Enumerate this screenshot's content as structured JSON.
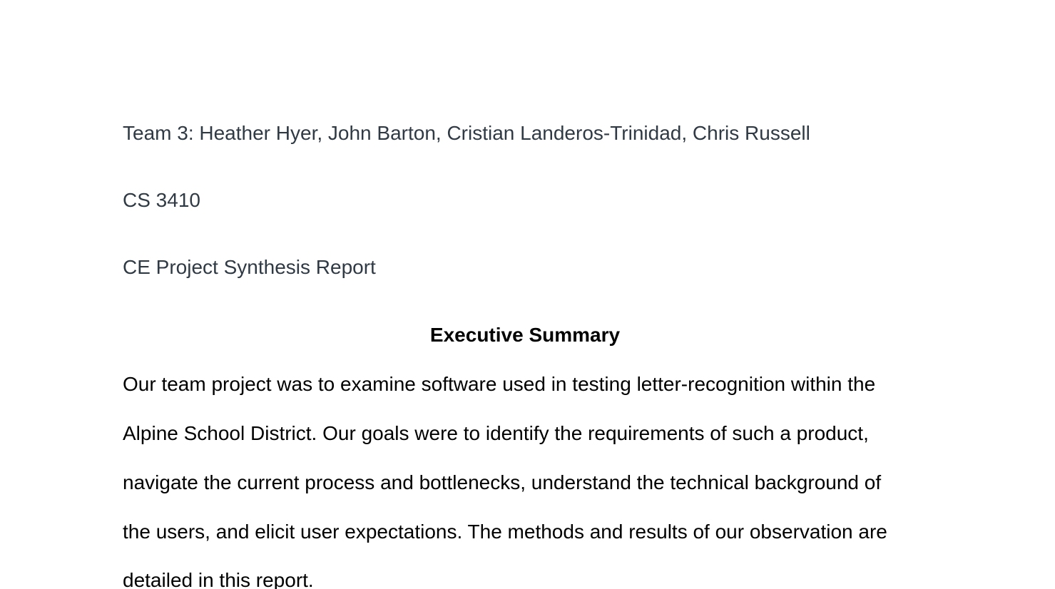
{
  "document": {
    "team_line": "Team 3: Heather Hyer, John Barton, Cristian Landeros-Trinidad, Chris Russell",
    "course": "CS 3410",
    "report_title": "CE Project Synthesis Report",
    "section_heading": "Executive Summary",
    "summary_lines": [
      "Our team project was to examine software used in testing letter-recognition within the",
      "Alpine School District. Our goals were to identify the requirements of such a product,",
      "navigate the current process and bottlenecks, understand the technical background of",
      "the users, and elicit user expectations. The methods and results of our observation are",
      "detailed in this report."
    ]
  }
}
